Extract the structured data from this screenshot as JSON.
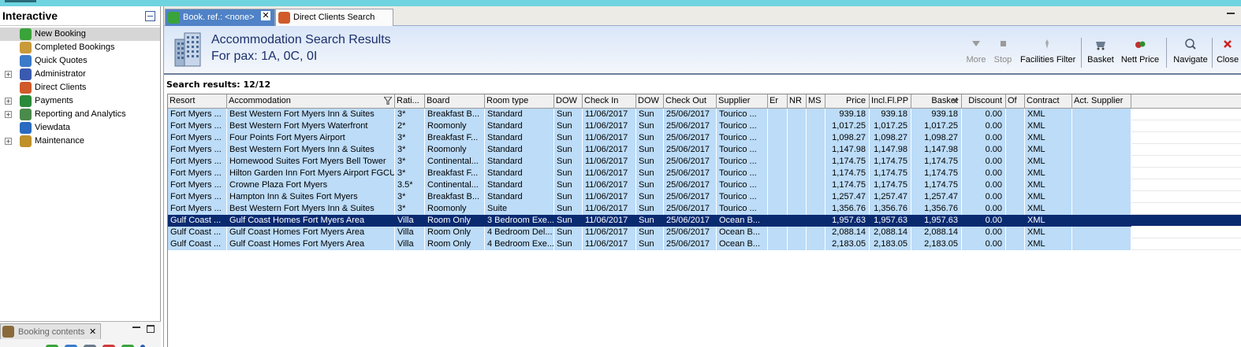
{
  "left_panel": {
    "title": "Interactive",
    "tree": [
      {
        "label": "New Booking",
        "icon": "palm-tree-icon",
        "color": "#3aa33a",
        "expandable": false,
        "selected": true
      },
      {
        "label": "Completed Bookings",
        "icon": "folder-palm-icon",
        "color": "#c99a3a",
        "expandable": false,
        "selected": false
      },
      {
        "label": "Quick Quotes",
        "icon": "globe-icon",
        "color": "#3a7ac9",
        "expandable": false,
        "selected": false
      },
      {
        "label": "Administrator",
        "icon": "person-icon",
        "color": "#3a5ab0",
        "expandable": true,
        "selected": false
      },
      {
        "label": "Direct Clients",
        "icon": "clients-icon",
        "color": "#d05a2a",
        "expandable": false,
        "selected": false
      },
      {
        "label": "Payments",
        "icon": "payments-icon",
        "color": "#2a8a3a",
        "expandable": true,
        "selected": false
      },
      {
        "label": "Reporting and Analytics",
        "icon": "report-icon",
        "color": "#4a8a4a",
        "expandable": true,
        "selected": false
      },
      {
        "label": "Viewdata",
        "icon": "viewdata-icon",
        "color": "#2a6ac0",
        "expandable": false,
        "selected": false
      },
      {
        "label": "Maintenance",
        "icon": "maintenance-icon",
        "color": "#c0902a",
        "expandable": true,
        "selected": false
      }
    ],
    "booking_contents": {
      "label": "Booking contents"
    }
  },
  "tabs": [
    {
      "label": "Book. ref.: <none>",
      "active": true
    },
    {
      "label": "Direct Clients Search",
      "active": false
    }
  ],
  "header": {
    "title": "Accommodation Search Results",
    "subtitle": "For pax: 1A, 0C, 0I"
  },
  "toolbar": {
    "more": "More",
    "stop": "Stop",
    "facilities_filter": "Facilities Filter",
    "basket": "Basket",
    "nett_price": "Nett Price",
    "navigate": "Navigate",
    "close": "Close"
  },
  "results": {
    "label": "Search results: 12/12",
    "columns": [
      "Resort",
      "Accommodation",
      "Rati...",
      "Board",
      "Room type",
      "DOW",
      "Check In",
      "DOW",
      "Check Out",
      "Supplier",
      "Er",
      "NR",
      "MS",
      "Price",
      "Incl.Fl.PP",
      "Basket",
      "Discount",
      "Of",
      "Contract",
      "Act. Supplier"
    ],
    "rows": [
      [
        "Fort Myers ...",
        "Best Western Fort Myers Inn & Suites",
        "3*",
        "Breakfast B...",
        "Standard",
        "Sun",
        "11/06/2017",
        "Sun",
        "25/06/2017",
        "Tourico ...",
        "",
        "",
        "",
        "939.18",
        "939.18",
        "939.18",
        "0.00",
        "",
        "XML",
        ""
      ],
      [
        "Fort Myers ...",
        "Best Western Fort Myers Waterfront",
        "2*",
        "Roomonly",
        "Standard",
        "Sun",
        "11/06/2017",
        "Sun",
        "25/06/2017",
        "Tourico ...",
        "",
        "",
        "",
        "1,017.25",
        "1,017.25",
        "1,017.25",
        "0.00",
        "",
        "XML",
        ""
      ],
      [
        "Fort Myers ...",
        "Four Points Fort Myers Airport",
        "3*",
        "Breakfast F...",
        "Standard",
        "Sun",
        "11/06/2017",
        "Sun",
        "25/06/2017",
        "Tourico ...",
        "",
        "",
        "",
        "1,098.27",
        "1,098.27",
        "1,098.27",
        "0.00",
        "",
        "XML",
        ""
      ],
      [
        "Fort Myers ...",
        "Best Western Fort Myers Inn & Suites",
        "3*",
        "Roomonly",
        "Standard",
        "Sun",
        "11/06/2017",
        "Sun",
        "25/06/2017",
        "Tourico ...",
        "",
        "",
        "",
        "1,147.98",
        "1,147.98",
        "1,147.98",
        "0.00",
        "",
        "XML",
        ""
      ],
      [
        "Fort Myers ...",
        "Homewood Suites Fort Myers Bell Tower",
        "3*",
        "Continental...",
        "Standard",
        "Sun",
        "11/06/2017",
        "Sun",
        "25/06/2017",
        "Tourico ...",
        "",
        "",
        "",
        "1,174.75",
        "1,174.75",
        "1,174.75",
        "0.00",
        "",
        "XML",
        ""
      ],
      [
        "Fort Myers ...",
        "Hilton Garden Inn Fort Myers Airport FGCU",
        "3*",
        "Breakfast F...",
        "Standard",
        "Sun",
        "11/06/2017",
        "Sun",
        "25/06/2017",
        "Tourico ...",
        "",
        "",
        "",
        "1,174.75",
        "1,174.75",
        "1,174.75",
        "0.00",
        "",
        "XML",
        ""
      ],
      [
        "Fort Myers ...",
        "Crowne Plaza Fort Myers",
        "3.5*",
        "Continental...",
        "Standard",
        "Sun",
        "11/06/2017",
        "Sun",
        "25/06/2017",
        "Tourico ...",
        "",
        "",
        "",
        "1,174.75",
        "1,174.75",
        "1,174.75",
        "0.00",
        "",
        "XML",
        ""
      ],
      [
        "Fort Myers ...",
        "Hampton Inn & Suites Fort Myers",
        "3*",
        "Breakfast B...",
        "Standard",
        "Sun",
        "11/06/2017",
        "Sun",
        "25/06/2017",
        "Tourico ...",
        "",
        "",
        "",
        "1,257.47",
        "1,257.47",
        "1,257.47",
        "0.00",
        "",
        "XML",
        ""
      ],
      [
        "Fort Myers ...",
        "Best Western Fort Myers Inn & Suites",
        "3*",
        "Roomonly",
        "Suite",
        "Sun",
        "11/06/2017",
        "Sun",
        "25/06/2017",
        "Tourico ...",
        "",
        "",
        "",
        "1,356.76",
        "1,356.76",
        "1,356.76",
        "0.00",
        "",
        "XML",
        ""
      ],
      [
        "Gulf Coast ...",
        "Gulf Coast Homes Fort Myers Area",
        "Villa",
        "Room Only",
        "3 Bedroom Exe...",
        "Sun",
        "11/06/2017",
        "Sun",
        "25/06/2017",
        "Ocean B...",
        "",
        "",
        "",
        "1,957.63",
        "1,957.63",
        "1,957.63",
        "0.00",
        "",
        "XML",
        ""
      ],
      [
        "Gulf Coast ...",
        "Gulf Coast Homes Fort Myers Area",
        "Villa",
        "Room Only",
        "4 Bedroom Del...",
        "Sun",
        "11/06/2017",
        "Sun",
        "25/06/2017",
        "Ocean B...",
        "",
        "",
        "",
        "2,088.14",
        "2,088.14",
        "2,088.14",
        "0.00",
        "",
        "XML",
        ""
      ],
      [
        "Gulf Coast ...",
        "Gulf Coast Homes Fort Myers Area",
        "Villa",
        "Room Only",
        "4 Bedroom Exe...",
        "Sun",
        "11/06/2017",
        "Sun",
        "25/06/2017",
        "Ocean B...",
        "",
        "",
        "",
        "2,183.05",
        "2,183.05",
        "2,183.05",
        "0.00",
        "",
        "XML",
        ""
      ]
    ],
    "selected_row": 9
  },
  "colors": {
    "accent": "#4f82c6",
    "row_fill": "#bcdcf8",
    "row_selected": "#0a2a70",
    "header_text": "#1b2f6b"
  }
}
